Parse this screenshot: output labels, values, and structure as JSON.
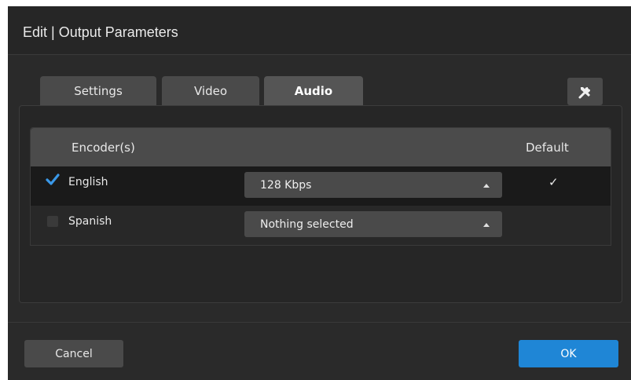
{
  "dialog": {
    "title": "Edit | Output Parameters"
  },
  "tabs": [
    {
      "label": "Settings",
      "active": false
    },
    {
      "label": "Video",
      "active": false
    },
    {
      "label": "Audio",
      "active": true
    }
  ],
  "toolbar": {
    "tools_icon": "tools-icon"
  },
  "table": {
    "headers": {
      "encoder": "Encoder(s)",
      "default": "Default"
    },
    "rows": [
      {
        "checked": true,
        "label": "English",
        "bitrate": "128 Kbps",
        "default_mark": "✓"
      },
      {
        "checked": false,
        "label": "Spanish",
        "bitrate": "Nothing selected",
        "default_mark": ""
      }
    ]
  },
  "footer": {
    "cancel_label": "Cancel",
    "ok_label": "OK"
  },
  "colors": {
    "accent": "#1f86d6",
    "check": "#3a98e8"
  }
}
